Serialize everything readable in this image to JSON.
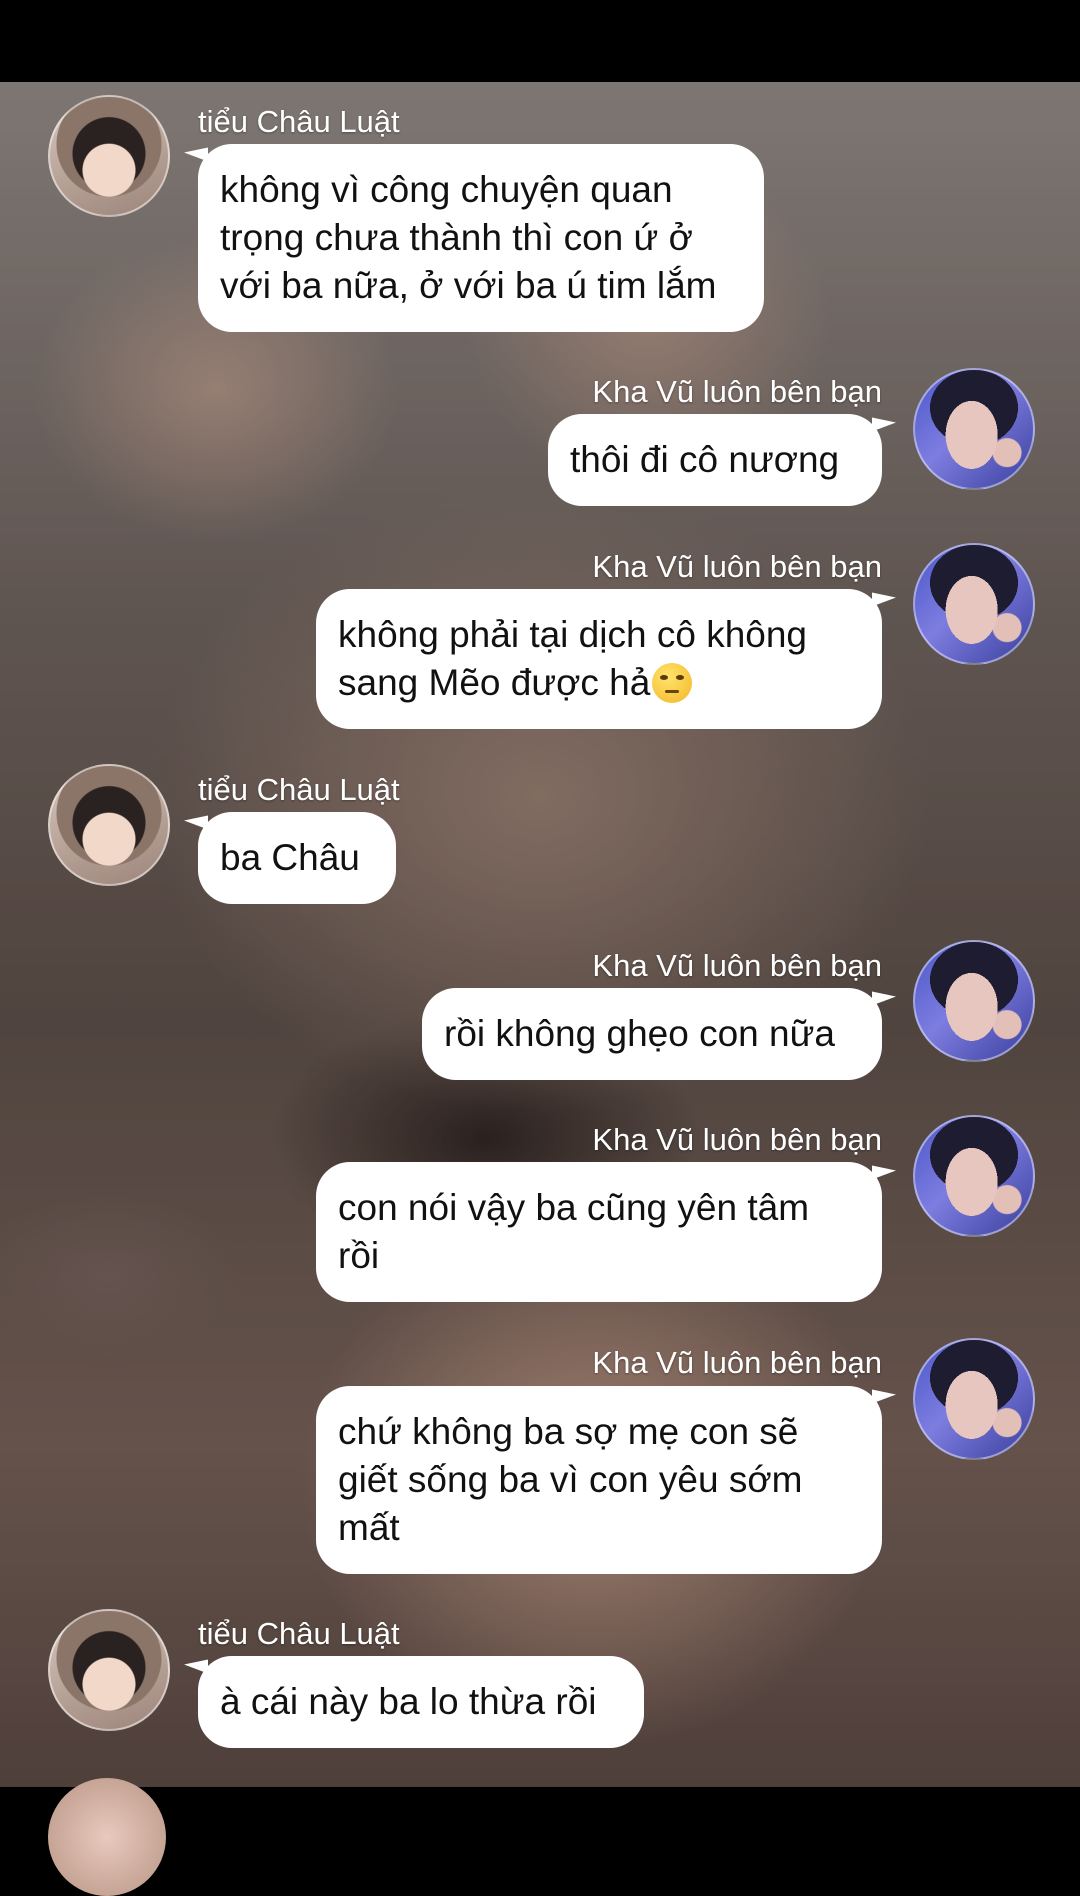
{
  "chat": {
    "messages": [
      {
        "side": "left",
        "sender": "tiểu Châu Luật",
        "lines": [
          "không vì công chuyện quan",
          "trọng chưa thành thì con ứ ở",
          "với ba nữa, ở với ba ú tim lắm"
        ]
      },
      {
        "side": "right",
        "sender": "Kha Vũ luôn bên bạn",
        "lines": [
          "thôi đi cô nương"
        ]
      },
      {
        "side": "right",
        "sender": "Kha Vũ luôn bên bạn",
        "lines": [
          "không phải tại dịch cô không",
          "sang Mẽo được hả"
        ],
        "emoji": "face-with-rolling-eyes-emoji"
      },
      {
        "side": "left",
        "sender": "tiểu Châu Luật",
        "lines": [
          "ba Châu"
        ]
      },
      {
        "side": "right",
        "sender": "Kha Vũ luôn bên bạn",
        "lines": [
          "rồi không ghẹo con nữa"
        ]
      },
      {
        "side": "right",
        "sender": "Kha Vũ luôn bên bạn",
        "lines": [
          "con nói vậy ba cũng yên tâm",
          "rồi"
        ]
      },
      {
        "side": "right",
        "sender": "Kha Vũ luôn bên bạn",
        "lines": [
          "chứ không ba sợ mẹ con sẽ",
          "giết sống ba vì con yêu sớm",
          "mất"
        ]
      },
      {
        "side": "left",
        "sender": "tiểu Châu Luật",
        "lines": [
          "à cái này ba lo thừa rồi"
        ]
      }
    ]
  },
  "colors": {
    "bubble": "#ffffff",
    "bubble_text": "#111111",
    "sender_text": "#ffffff",
    "status_bar": "#000000"
  }
}
